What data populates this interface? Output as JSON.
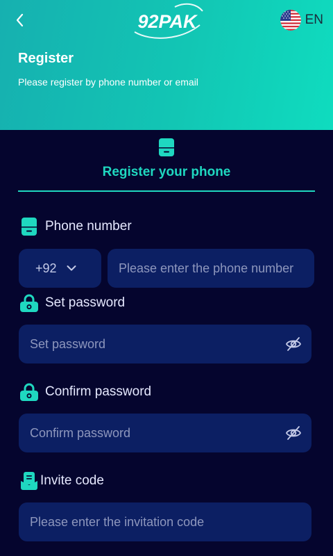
{
  "header": {
    "brand": "92PAK",
    "language": "EN",
    "title": "Register",
    "subtitle": "Please register by phone number or email"
  },
  "tab": {
    "label": "Register your phone"
  },
  "phone": {
    "label": "Phone number",
    "country_code": "+92",
    "placeholder": "Please enter the phone number"
  },
  "password": {
    "label": "Set password",
    "placeholder": "Set password"
  },
  "confirm_password": {
    "label": "Confirm password",
    "placeholder": "Confirm password"
  },
  "invite": {
    "label": "Invite code",
    "placeholder": "Please enter the invitation code"
  },
  "colors": {
    "accent": "#1fd8c0",
    "background": "#05052e",
    "input_bg": "#0c1f63"
  },
  "icons": {
    "back": "chevron-left-icon",
    "flag": "us-flag-icon",
    "phone": "phone-icon",
    "lock": "lock-icon",
    "eye_off": "eye-off-icon",
    "dropdown": "chevron-down-icon",
    "invite": "invite-icon"
  }
}
